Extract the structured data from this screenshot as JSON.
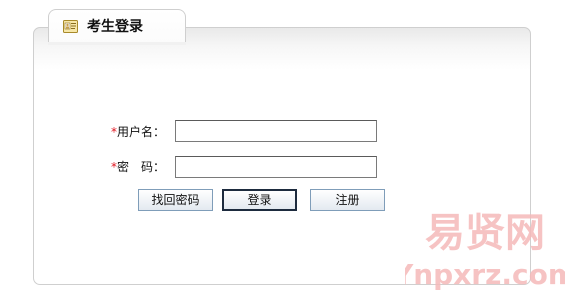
{
  "tab": {
    "title": "考生登录",
    "icon": "id-card-icon"
  },
  "form": {
    "required_mark": "*",
    "username_label": "用户名：",
    "password_label": "密　码：",
    "username_value": "",
    "password_value": ""
  },
  "buttons": {
    "find_password": "找回密码",
    "login": "登录",
    "register": "注册"
  },
  "watermark": {
    "line1": "易贤网",
    "line2": "Ynpxrz.com",
    "color": "#f4b8b8"
  }
}
